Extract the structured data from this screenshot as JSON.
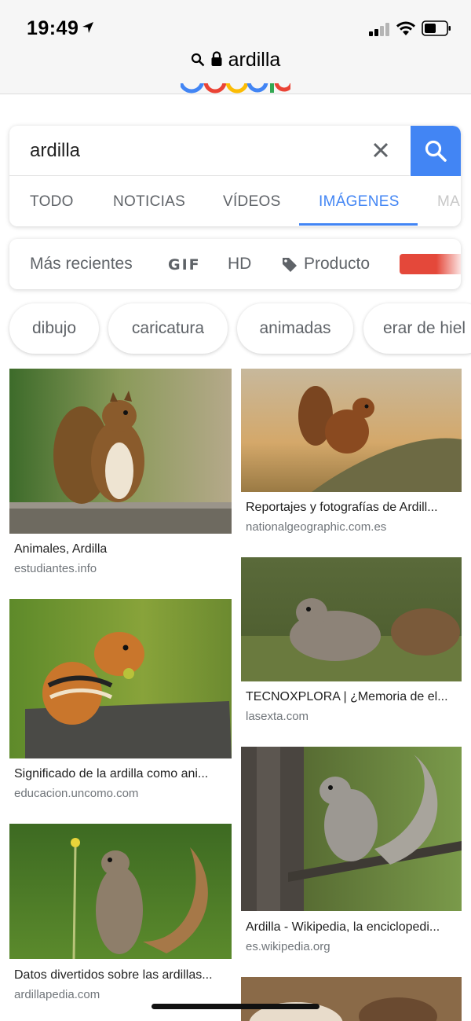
{
  "status_bar": {
    "time": "19:49"
  },
  "url_bar": {
    "text": "ardilla"
  },
  "search": {
    "query": "ardilla"
  },
  "tabs": [
    {
      "label": "TODO"
    },
    {
      "label": "NOTICIAS"
    },
    {
      "label": "VÍDEOS"
    },
    {
      "label": "IMÁGENES",
      "active": true
    },
    {
      "label": "MA"
    }
  ],
  "filters": {
    "recent": "Más recientes",
    "gif": "GIF",
    "hd": "HD",
    "product": "Producto"
  },
  "chips": [
    "dibujo",
    "caricatura",
    "animadas",
    "erar de hiel"
  ],
  "results": [
    {
      "title": "Animales, Ardilla",
      "source": "estudiantes.info"
    },
    {
      "title": "Reportajes y fotografías de Ardill...",
      "source": "nationalgeographic.com.es"
    },
    {
      "title": "Significado de la ardilla como ani...",
      "source": "educacion.uncomo.com"
    },
    {
      "title": "TECNOXPLORA | ¿Memoria de el...",
      "source": "lasexta.com"
    },
    {
      "title": "Datos divertidos sobre las ardillas...",
      "source": "ardillapedia.com"
    },
    {
      "title": "Ardilla - Wikipedia, la enciclopedi...",
      "source": "es.wikipedia.org"
    }
  ],
  "colors": {
    "accent": "#4285f4",
    "chip_red": "#e4483a"
  }
}
